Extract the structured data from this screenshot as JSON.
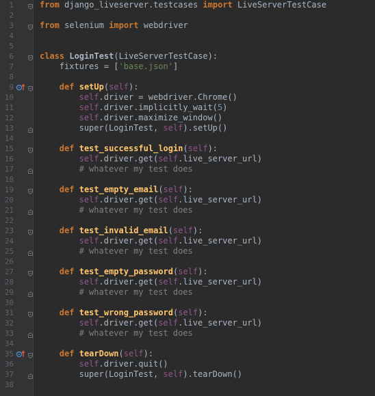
{
  "editor": {
    "lines": [
      {
        "n": "1",
        "marker": "",
        "fold": "start",
        "indent": 0,
        "tokens": [
          {
            "t": "from",
            "c": "kw"
          },
          {
            "t": " django_liveserver.testcases ",
            "c": "plain"
          },
          {
            "t": "import",
            "c": "kw"
          },
          {
            "t": " LiveServerTestCase",
            "c": "plain"
          }
        ]
      },
      {
        "n": "2",
        "marker": "",
        "fold": "",
        "indent": 0,
        "tokens": []
      },
      {
        "n": "3",
        "marker": "",
        "fold": "start",
        "indent": 0,
        "tokens": [
          {
            "t": "from",
            "c": "kw"
          },
          {
            "t": " selenium ",
            "c": "plain"
          },
          {
            "t": "import",
            "c": "kw"
          },
          {
            "t": " webdriver",
            "c": "plain"
          }
        ]
      },
      {
        "n": "4",
        "marker": "",
        "fold": "",
        "indent": 0,
        "tokens": []
      },
      {
        "n": "5",
        "marker": "",
        "fold": "",
        "indent": 0,
        "tokens": []
      },
      {
        "n": "6",
        "marker": "",
        "fold": "start",
        "indent": 0,
        "tokens": [
          {
            "t": "class",
            "c": "kw"
          },
          {
            "t": " ",
            "c": "plain"
          },
          {
            "t": "LoginTest",
            "c": "cls"
          },
          {
            "t": "(LiveServerTestCase):",
            "c": "plain"
          }
        ]
      },
      {
        "n": "7",
        "marker": "",
        "fold": "",
        "indent": 4,
        "tokens": [
          {
            "t": "fixtures = [",
            "c": "plain"
          },
          {
            "t": "'base.json'",
            "c": "str"
          },
          {
            "t": "]",
            "c": "plain"
          }
        ]
      },
      {
        "n": "8",
        "marker": "",
        "fold": "",
        "indent": 0,
        "tokens": []
      },
      {
        "n": "9",
        "marker": "override",
        "fold": "start",
        "indent": 4,
        "tokens": [
          {
            "t": "def",
            "c": "kw"
          },
          {
            "t": " ",
            "c": "plain"
          },
          {
            "t": "setUp",
            "c": "fn"
          },
          {
            "t": "(",
            "c": "plain"
          },
          {
            "t": "self",
            "c": "self"
          },
          {
            "t": "):",
            "c": "plain"
          }
        ]
      },
      {
        "n": "10",
        "marker": "",
        "fold": "",
        "indent": 8,
        "tokens": [
          {
            "t": "self",
            "c": "self"
          },
          {
            "t": ".driver = webdriver.Chrome()",
            "c": "plain"
          }
        ]
      },
      {
        "n": "11",
        "marker": "",
        "fold": "",
        "indent": 8,
        "tokens": [
          {
            "t": "self",
            "c": "self"
          },
          {
            "t": ".driver.implicitly_wait(",
            "c": "plain"
          },
          {
            "t": "5",
            "c": "num"
          },
          {
            "t": ")",
            "c": "plain"
          }
        ]
      },
      {
        "n": "12",
        "marker": "",
        "fold": "",
        "indent": 8,
        "tokens": [
          {
            "t": "self",
            "c": "self"
          },
          {
            "t": ".driver.maximize_window()",
            "c": "plain"
          }
        ]
      },
      {
        "n": "13",
        "marker": "",
        "fold": "end",
        "indent": 8,
        "tokens": [
          {
            "t": "super",
            "c": "plain"
          },
          {
            "t": "(LoginTest, ",
            "c": "plain"
          },
          {
            "t": "self",
            "c": "self"
          },
          {
            "t": ").setUp()",
            "c": "plain"
          }
        ]
      },
      {
        "n": "14",
        "marker": "",
        "fold": "",
        "indent": 0,
        "tokens": []
      },
      {
        "n": "15",
        "marker": "",
        "fold": "start",
        "indent": 4,
        "tokens": [
          {
            "t": "def",
            "c": "kw"
          },
          {
            "t": " ",
            "c": "plain"
          },
          {
            "t": "test_successful_login",
            "c": "fn"
          },
          {
            "t": "(",
            "c": "plain"
          },
          {
            "t": "self",
            "c": "self"
          },
          {
            "t": "):",
            "c": "plain"
          }
        ]
      },
      {
        "n": "16",
        "marker": "",
        "fold": "",
        "indent": 8,
        "tokens": [
          {
            "t": "self",
            "c": "self"
          },
          {
            "t": ".driver.get(",
            "c": "plain"
          },
          {
            "t": "self",
            "c": "self"
          },
          {
            "t": ".live_server_url)",
            "c": "plain"
          }
        ]
      },
      {
        "n": "17",
        "marker": "",
        "fold": "end",
        "indent": 8,
        "tokens": [
          {
            "t": "# whatever my test does",
            "c": "cm"
          }
        ]
      },
      {
        "n": "18",
        "marker": "",
        "fold": "",
        "indent": 0,
        "tokens": []
      },
      {
        "n": "19",
        "marker": "",
        "fold": "start",
        "indent": 4,
        "tokens": [
          {
            "t": "def",
            "c": "kw"
          },
          {
            "t": " ",
            "c": "plain"
          },
          {
            "t": "test_empty_email",
            "c": "fn"
          },
          {
            "t": "(",
            "c": "plain"
          },
          {
            "t": "self",
            "c": "self"
          },
          {
            "t": "):",
            "c": "plain"
          }
        ]
      },
      {
        "n": "20",
        "marker": "",
        "fold": "",
        "indent": 8,
        "tokens": [
          {
            "t": "self",
            "c": "self"
          },
          {
            "t": ".driver.get(",
            "c": "plain"
          },
          {
            "t": "self",
            "c": "self"
          },
          {
            "t": ".live_server_url)",
            "c": "plain"
          }
        ]
      },
      {
        "n": "21",
        "marker": "",
        "fold": "end",
        "indent": 8,
        "tokens": [
          {
            "t": "# whatever my test does",
            "c": "cm"
          }
        ]
      },
      {
        "n": "22",
        "marker": "",
        "fold": "",
        "indent": 0,
        "tokens": []
      },
      {
        "n": "23",
        "marker": "",
        "fold": "start",
        "indent": 4,
        "tokens": [
          {
            "t": "def",
            "c": "kw"
          },
          {
            "t": " ",
            "c": "plain"
          },
          {
            "t": "test_invalid_email",
            "c": "fn"
          },
          {
            "t": "(",
            "c": "plain"
          },
          {
            "t": "self",
            "c": "self"
          },
          {
            "t": "):",
            "c": "plain"
          }
        ]
      },
      {
        "n": "24",
        "marker": "",
        "fold": "",
        "indent": 8,
        "tokens": [
          {
            "t": "self",
            "c": "self"
          },
          {
            "t": ".driver.get(",
            "c": "plain"
          },
          {
            "t": "self",
            "c": "self"
          },
          {
            "t": ".live_server_url)",
            "c": "plain"
          }
        ]
      },
      {
        "n": "25",
        "marker": "",
        "fold": "end",
        "indent": 8,
        "tokens": [
          {
            "t": "# whatever my test does",
            "c": "cm"
          }
        ]
      },
      {
        "n": "26",
        "marker": "",
        "fold": "",
        "indent": 0,
        "tokens": []
      },
      {
        "n": "27",
        "marker": "",
        "fold": "start",
        "indent": 4,
        "tokens": [
          {
            "t": "def",
            "c": "kw"
          },
          {
            "t": " ",
            "c": "plain"
          },
          {
            "t": "test_empty_password",
            "c": "fn"
          },
          {
            "t": "(",
            "c": "plain"
          },
          {
            "t": "self",
            "c": "self"
          },
          {
            "t": "):",
            "c": "plain"
          }
        ]
      },
      {
        "n": "28",
        "marker": "",
        "fold": "",
        "indent": 8,
        "tokens": [
          {
            "t": "self",
            "c": "self"
          },
          {
            "t": ".driver.get(",
            "c": "plain"
          },
          {
            "t": "self",
            "c": "self"
          },
          {
            "t": ".live_server_url)",
            "c": "plain"
          }
        ]
      },
      {
        "n": "29",
        "marker": "",
        "fold": "end",
        "indent": 8,
        "tokens": [
          {
            "t": "# whatever my test does",
            "c": "cm"
          }
        ]
      },
      {
        "n": "30",
        "marker": "",
        "fold": "",
        "indent": 0,
        "tokens": []
      },
      {
        "n": "31",
        "marker": "",
        "fold": "start",
        "indent": 4,
        "tokens": [
          {
            "t": "def",
            "c": "kw"
          },
          {
            "t": " ",
            "c": "plain"
          },
          {
            "t": "test_wrong_password",
            "c": "fn"
          },
          {
            "t": "(",
            "c": "plain"
          },
          {
            "t": "self",
            "c": "self"
          },
          {
            "t": "):",
            "c": "plain"
          }
        ]
      },
      {
        "n": "32",
        "marker": "",
        "fold": "",
        "indent": 8,
        "tokens": [
          {
            "t": "self",
            "c": "self"
          },
          {
            "t": ".driver.get(",
            "c": "plain"
          },
          {
            "t": "self",
            "c": "self"
          },
          {
            "t": ".live_server_url)",
            "c": "plain"
          }
        ]
      },
      {
        "n": "33",
        "marker": "",
        "fold": "end",
        "indent": 8,
        "tokens": [
          {
            "t": "# whatever my test does",
            "c": "cm"
          }
        ]
      },
      {
        "n": "34",
        "marker": "",
        "fold": "",
        "indent": 0,
        "tokens": []
      },
      {
        "n": "35",
        "marker": "override",
        "fold": "start",
        "indent": 4,
        "tokens": [
          {
            "t": "def",
            "c": "kw"
          },
          {
            "t": " ",
            "c": "plain"
          },
          {
            "t": "tearDown",
            "c": "fn"
          },
          {
            "t": "(",
            "c": "plain"
          },
          {
            "t": "self",
            "c": "self"
          },
          {
            "t": "):",
            "c": "plain"
          }
        ]
      },
      {
        "n": "36",
        "marker": "",
        "fold": "",
        "indent": 8,
        "tokens": [
          {
            "t": "self",
            "c": "self"
          },
          {
            "t": ".driver.quit()",
            "c": "plain"
          }
        ]
      },
      {
        "n": "37",
        "marker": "",
        "fold": "end",
        "indent": 8,
        "tokens": [
          {
            "t": "super",
            "c": "plain"
          },
          {
            "t": "(LoginTest, ",
            "c": "plain"
          },
          {
            "t": "self",
            "c": "self"
          },
          {
            "t": ").tearDown()",
            "c": "plain"
          }
        ]
      },
      {
        "n": "38",
        "marker": "",
        "fold": "",
        "indent": 0,
        "tokens": []
      }
    ]
  },
  "colors": {
    "background": "#2b2b2b",
    "gutter": "#313335",
    "keyword": "#cc7832",
    "self": "#94558d",
    "function": "#ffc66d",
    "string": "#6a8759",
    "number": "#6897bb",
    "comment": "#808080",
    "text": "#a9b7c6"
  },
  "icons": {
    "override_marker": "override-method-icon",
    "fold_start": "fold-collapse-icon",
    "fold_end": "fold-end-icon"
  }
}
